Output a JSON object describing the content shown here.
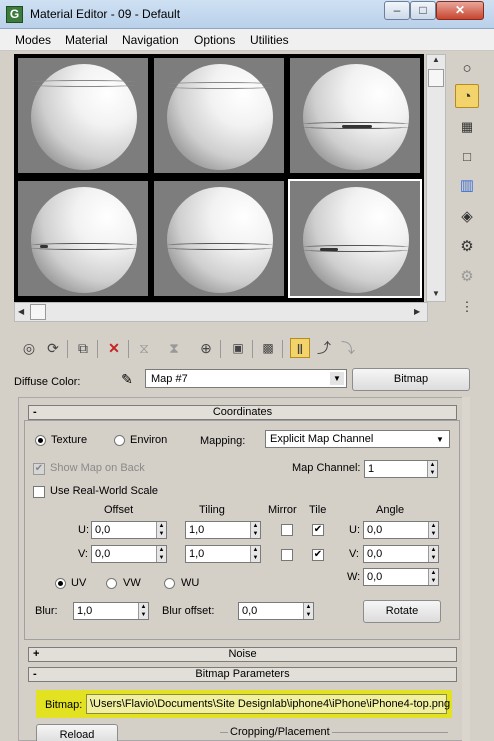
{
  "window": {
    "title": "Material Editor - 09 - Default",
    "app_icon": "G",
    "controls": {
      "minimize": "–",
      "maximize": "□",
      "close": "✕"
    }
  },
  "menu": [
    "Modes",
    "Material",
    "Navigation",
    "Options",
    "Utilities"
  ],
  "sample_slots": {
    "count": 6,
    "active_index": 5
  },
  "right_toolbar_icons": [
    "sample-type-sphere-icon",
    "backlight-icon",
    "background-checker-icon",
    "sample-uv-tiling-icon",
    "video-color-check-icon",
    "make-preview-icon",
    "options-icon",
    "select-by-material-icon",
    "material-map-navigator-icon"
  ],
  "bottom_toolbar_icons": [
    "get-material-icon",
    "put-material-icon",
    "assign-material-icon",
    "reset-map-icon",
    "make-copy-icon",
    "make-unique-icon",
    "put-to-library-icon",
    "material-id-channel-icon",
    "show-shaded-material-icon",
    "show-end-result-icon",
    "go-to-parent-icon",
    "go-forward-to-sibling-icon"
  ],
  "diffuse": {
    "label": "Diffuse Color:",
    "map_name": "Map #7",
    "type_button": "Bitmap"
  },
  "coordinates": {
    "rollout_title": "Coordinates",
    "collapse_sign": "-",
    "texture_label": "Texture",
    "environ_label": "Environ",
    "mapping_label": "Mapping:",
    "mapping_value": "Explicit Map Channel",
    "show_map_on_back": "Show Map on Back",
    "map_channel_label": "Map Channel:",
    "map_channel_value": "1",
    "use_real_world_scale": "Use Real-World Scale",
    "headers": {
      "offset": "Offset",
      "tiling": "Tiling",
      "mirror": "Mirror",
      "tile": "Tile",
      "angle": "Angle"
    },
    "u_label": "U:",
    "v_label": "V:",
    "w_label": "W:",
    "offset_u": "0,0",
    "offset_v": "0,0",
    "tiling_u": "1,0",
    "tiling_v": "1,0",
    "tile_check": "✔",
    "angle_u": "0,0",
    "angle_v": "0,0",
    "angle_w": "0,0",
    "uv_label": "UV",
    "vw_label": "VW",
    "wu_label": "WU",
    "blur_label": "Blur:",
    "blur_value": "1,0",
    "blur_offset_label": "Blur offset:",
    "blur_offset_value": "0,0",
    "rotate_button": "Rotate"
  },
  "noise": {
    "rollout_title": "Noise",
    "collapse_sign": "+"
  },
  "bitmap_params": {
    "rollout_title": "Bitmap Parameters",
    "collapse_sign": "-",
    "bitmap_label": "Bitmap:",
    "bitmap_path": "\\Users\\Flavio\\Documents\\Site Designlab\\iphone4\\iPhone\\iPhone4-top.png",
    "reload_button": "Reload",
    "cropping_label": "Cropping/Placement"
  },
  "colors": {
    "highlight": "#e2e223",
    "active_tool": "#f3d36b",
    "panel_bg": "#d4d0c8"
  }
}
